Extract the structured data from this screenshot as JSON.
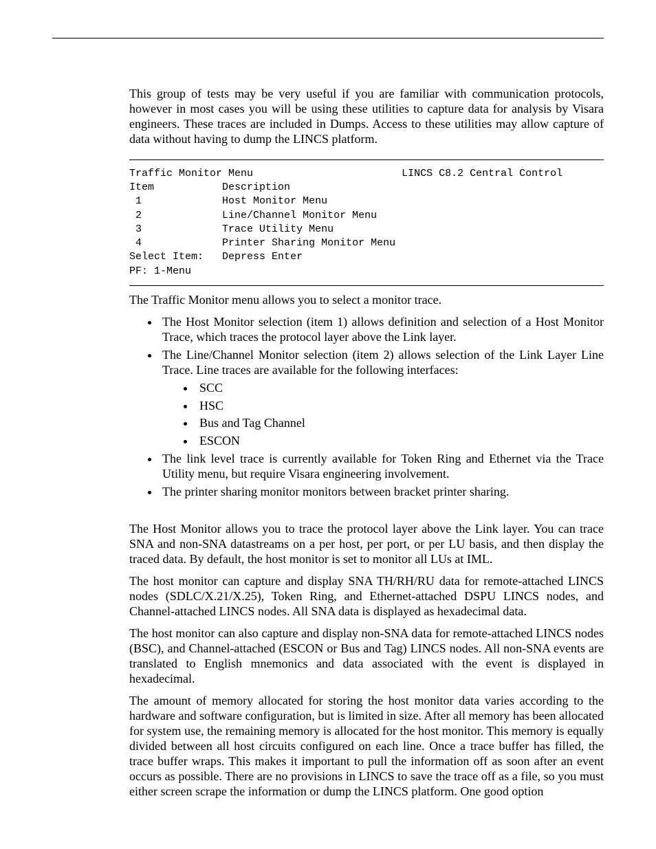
{
  "intro": "This group of tests may be very useful if you are familiar with communication protocols, however in most cases you will be using these utilities to capture data for analysis by Visara engineers. These traces are included in Dumps. Access to these utilities may allow capture of data without having to dump the LINCS platform.",
  "code": {
    "title_left": "Traffic Monitor Menu",
    "title_right": "LINCS C8.2 Central Control",
    "hdr_item": "Item",
    "hdr_desc": "Description",
    "rows": [
      {
        "n": " 1",
        "d": "Host Monitor Menu"
      },
      {
        "n": " 2",
        "d": "Line/Channel Monitor Menu"
      },
      {
        "n": " 3",
        "d": "Trace Utility Menu"
      },
      {
        "n": " 4",
        "d": "Printer Sharing Monitor Menu"
      }
    ],
    "select_label": "Select Item:",
    "select_value": "Depress Enter",
    "pf": "PF: 1-Menu"
  },
  "after_code": "The Traffic Monitor menu allows you to select a monitor trace.",
  "bullets": {
    "b1": "The Host Monitor selection (item 1) allows definition and selection of a Host Monitor Trace, which traces the protocol layer above the Link layer.",
    "b2": "The Line/Channel Monitor selection (item 2) allows selection of the Link Layer Line Trace. Line traces are available for the following interfaces:",
    "b2_sub": [
      "SCC",
      "HSC",
      "Bus and Tag Channel",
      "ESCON"
    ],
    "b3": "The link level trace is currently available for Token Ring and Ethernet via the Trace Utility menu, but require Visara engineering involvement.",
    "b4": "The printer sharing monitor monitors between bracket printer sharing."
  },
  "p1": "The Host Monitor allows you to trace the protocol layer above the Link layer. You can trace SNA and non-SNA datastreams on a per host, per port, or per LU basis, and then display the traced data. By default, the host monitor is set to monitor all LUs at IML.",
  "p2": "The host monitor can capture and display SNA TH/RH/RU data for remote-attached LINCS nodes (SDLC/X.21/X.25), Token Ring, and Ethernet-attached DSPU LINCS nodes, and Channel-attached LINCS nodes. All SNA data is displayed as hexadecimal data.",
  "p3": "The host monitor can also capture and display non-SNA data for remote-attached LINCS nodes (BSC), and Channel-attached (ESCON or Bus and Tag) LINCS nodes. All non-SNA events are translated to English mnemonics and data associated with the event is displayed in hexadecimal.",
  "p4": "The amount of memory allocated for storing the host monitor data varies according to the hardware and software configuration, but is limited in size. After all memory has been allocated for system use, the remaining memory is allocated for the host monitor. This memory is equally divided between all host circuits configured on each line. Once a trace buffer has filled, the trace buffer wraps. This makes it important to pull the information off as soon after an event occurs as possible. There are no provisions in LINCS to save the trace off as a file, so you must either screen scrape the information or dump the LINCS platform. One good option"
}
